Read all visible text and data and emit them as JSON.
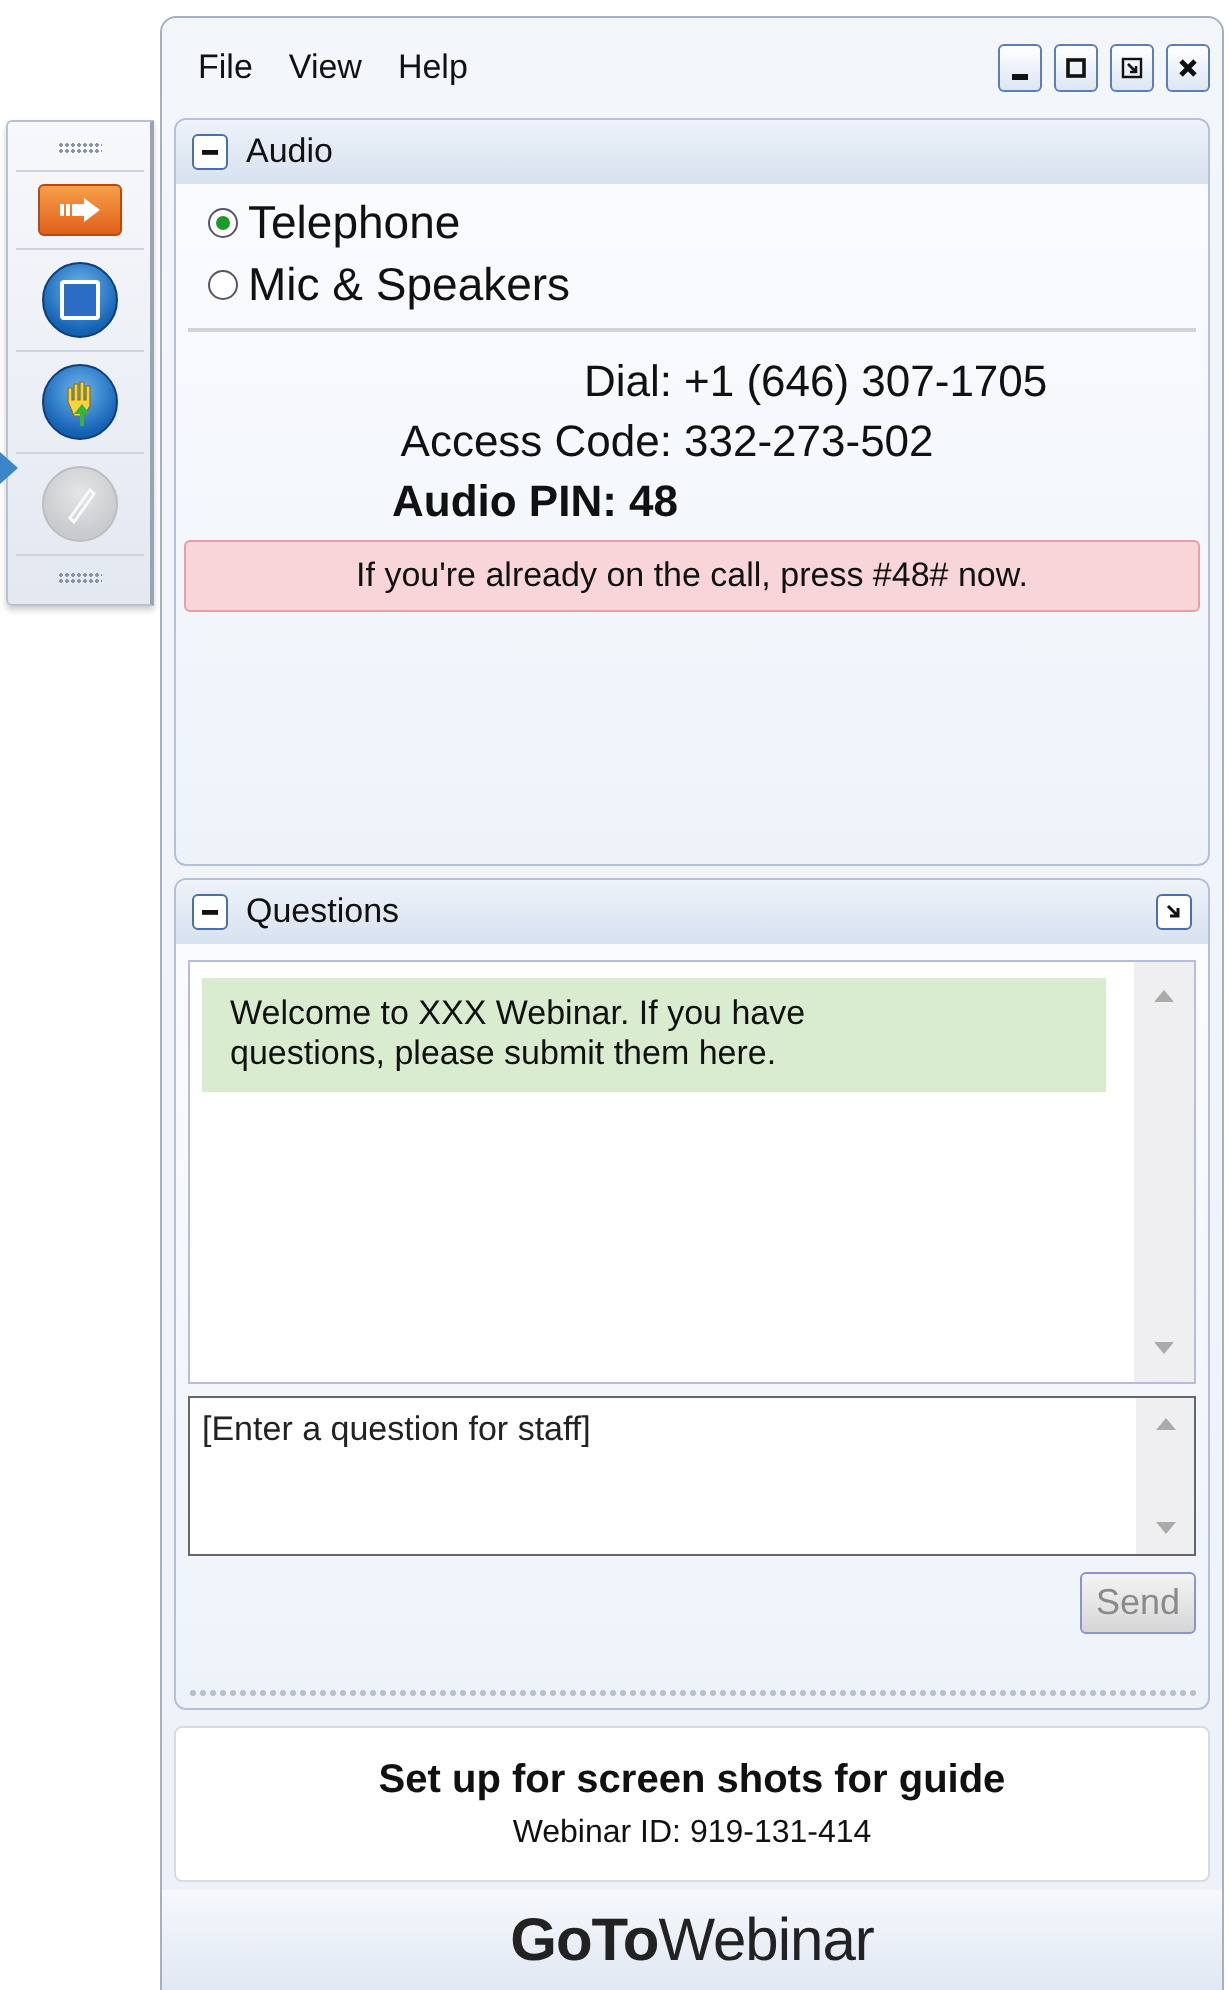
{
  "side_toolbar": {
    "buttons": [
      {
        "kind": "arrow",
        "disabled": false
      },
      {
        "kind": "stop",
        "disabled": false
      },
      {
        "kind": "hand",
        "disabled": false
      },
      {
        "kind": "pencil",
        "disabled": true
      }
    ]
  },
  "menu": [
    "File",
    "View",
    "Help"
  ],
  "audio": {
    "title": "Audio",
    "expanded": true,
    "options": [
      {
        "label": "Telephone",
        "selected": true
      },
      {
        "label": "Mic & Speakers",
        "selected": false
      }
    ],
    "details": [
      {
        "label": "Dial:",
        "value": "+1 (646) 307-1705"
      },
      {
        "label": "Access Code:",
        "value": "332-273-502"
      }
    ],
    "audio_pin": "Audio PIN: 48",
    "notice": "If you're already on the call, press #48# now."
  },
  "questions": {
    "title": "Questions",
    "expanded": true,
    "messages": [
      "Welcome to XXX Webinar. If you have questions, please submit them here."
    ],
    "input": {
      "placeholder": "[Enter a question for staff]"
    },
    "send": {
      "label": "Send",
      "disabled": true
    }
  },
  "webinar": {
    "title": "Set up for screen shots for guide",
    "id": "Webinar ID: 919-131-414"
  },
  "logo": "**GoTo**Webinar"
}
